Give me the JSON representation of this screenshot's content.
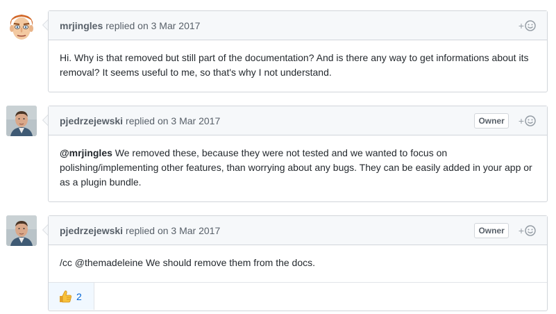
{
  "comments": [
    {
      "author": "mrjingles",
      "meta": "replied on 3 Mar 2017",
      "owner": "",
      "body": "Hi. Why is that removed but still part of the documentation? And is there any way to get informations about its removal? It seems useful to me, so that's why I not understand."
    },
    {
      "author": "pjedrzejewski",
      "meta": "replied on 3 Mar 2017",
      "owner": "Owner",
      "mention": "@mrjingles",
      "body": " We removed these, because they were not tested and we wanted to focus on polishing/implementing other features, than worrying about any bugs. They can be easily added in your app or as a plugin bundle."
    },
    {
      "author": "pjedrzejewski",
      "meta": "replied on 3 Mar 2017",
      "owner": "Owner",
      "body": "/cc @themadeleine We should remove them from the docs.",
      "reactions": [
        {
          "icon": "thumbs-up-icon",
          "count": "2"
        }
      ]
    }
  ],
  "reaction_plus": "+",
  "colors": {
    "header_bg": "#f6f8fa",
    "border": "#d1d5da",
    "link": "#0366d6",
    "reaction_bg": "#f1f8ff"
  }
}
